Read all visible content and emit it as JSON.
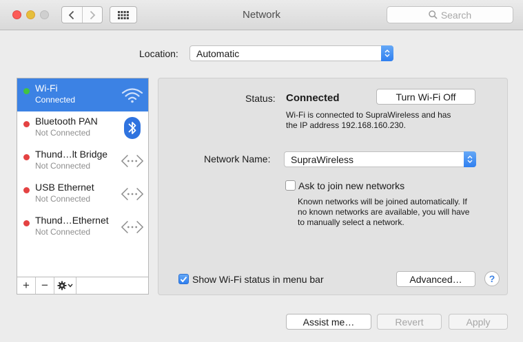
{
  "window": {
    "title": "Network",
    "search_placeholder": "Search"
  },
  "location": {
    "label": "Location:",
    "value": "Automatic"
  },
  "services": [
    {
      "name": "Wi-Fi",
      "status": "Connected",
      "indicator": "green",
      "icon": "wifi-icon"
    },
    {
      "name": "Bluetooth PAN",
      "status": "Not Connected",
      "indicator": "red",
      "icon": "bluetooth-icon"
    },
    {
      "name": "Thund…lt Bridge",
      "status": "Not Connected",
      "indicator": "red",
      "icon": "ethernet-arrows-icon"
    },
    {
      "name": "USB Ethernet",
      "status": "Not Connected",
      "indicator": "red",
      "icon": "ethernet-arrows-icon"
    },
    {
      "name": "Thund…Ethernet",
      "status": "Not Connected",
      "indicator": "red",
      "icon": "ethernet-arrows-icon"
    }
  ],
  "sidebar_tools": {
    "add": "+",
    "remove": "−"
  },
  "detail": {
    "status_label": "Status:",
    "status_value": "Connected",
    "toggle_button": "Turn Wi-Fi Off",
    "status_desc_1": "Wi-Fi is connected to SupraWireless and has",
    "status_desc_2": "the IP address 192.168.160.230.",
    "network_name_label": "Network Name:",
    "network_name_value": "SupraWireless",
    "ask_join_label": "Ask to join new networks",
    "ask_join_checked": false,
    "ask_join_note_1": "Known networks will be joined automatically. If",
    "ask_join_note_2": "no known networks are available, you will have",
    "ask_join_note_3": "to manually select a network.",
    "show_status_label": "Show Wi-Fi status in menu bar",
    "show_status_checked": true,
    "advanced_button": "Advanced…",
    "help_glyph": "?"
  },
  "footer": {
    "assist": "Assist me…",
    "revert": "Revert",
    "apply": "Apply"
  },
  "colors": {
    "selection": "#3c82e4",
    "connected": "#42c342",
    "disconnected": "#e44242",
    "accent": "#2f7ff0"
  }
}
